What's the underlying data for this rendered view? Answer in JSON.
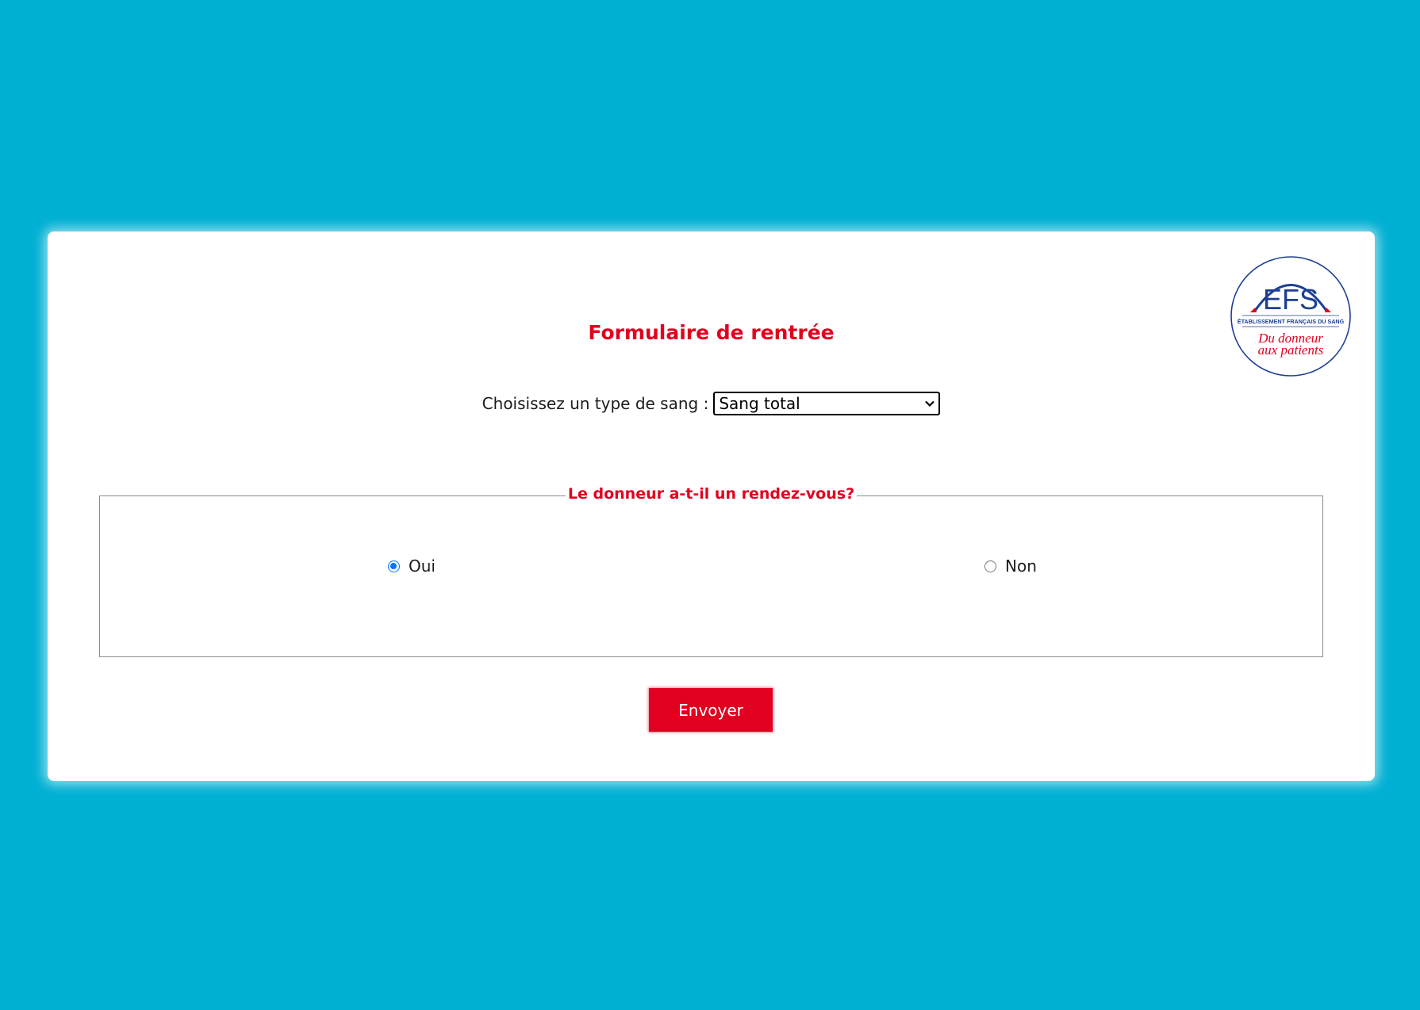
{
  "page": {
    "title": "Formulaire de rentrée"
  },
  "logo": {
    "main": "EFS",
    "subtitle": "ÉTABLISSEMENT FRANÇAIS DU SANG",
    "tagline_line1": "Du donneur",
    "tagline_line2": "aux patients",
    "colors": {
      "navy": "#1c3f94",
      "red": "#e1001f"
    }
  },
  "blood_type": {
    "label": "Choisissez un type de sang :",
    "selected": "Sang total"
  },
  "appointment": {
    "legend": "Le donneur a-t-il un rendez-vous?",
    "options": [
      {
        "label": "Oui",
        "checked": true
      },
      {
        "label": "Non",
        "checked": false
      }
    ]
  },
  "submit": {
    "label": "Envoyer"
  },
  "colors": {
    "background": "#00b0d3",
    "accent_red": "#e1001f",
    "radio_blue": "#0075ff"
  }
}
